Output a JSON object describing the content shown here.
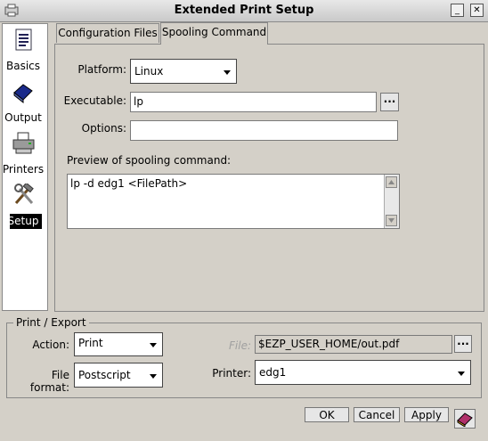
{
  "window": {
    "title": "Extended Print Setup",
    "min_label": "_",
    "max_label": "□",
    "close_label": "✕"
  },
  "sidebar": {
    "items": [
      {
        "label": "Basics",
        "icon": "document-icon"
      },
      {
        "label": "Output",
        "icon": "book-icon"
      },
      {
        "label": "Printers",
        "icon": "printer-icon"
      },
      {
        "label": "Setup",
        "icon": "tools-icon"
      }
    ],
    "selected": "Setup"
  },
  "tabs": [
    {
      "label": "Configuration Files"
    },
    {
      "label": "Spooling Command"
    }
  ],
  "spooling": {
    "platform_label": "Platform:",
    "platform_value": "Linux",
    "executable_label": "Executable:",
    "executable_value": "lp",
    "browse_label": "...",
    "options_label": "Options:",
    "options_value": "",
    "preview_label": "Preview of spooling command:",
    "preview_value": "lp -d edg1  <FilePath>"
  },
  "print_export": {
    "group_title": "Print / Export",
    "action_label": "Action:",
    "action_value": "Print",
    "file_label": "File:",
    "file_value": "$EZP_USER_HOME/out.pdf",
    "file_browse_label": "...",
    "format_label": "File format:",
    "format_value": "Postscript",
    "printer_label": "Printer:",
    "printer_value": "edg1"
  },
  "buttons": {
    "ok": "OK",
    "cancel": "Cancel",
    "apply": "Apply",
    "help_icon": "help-book-icon"
  },
  "colors": {
    "window_bg": "#d4d0c8",
    "sidebar_selected_bg": "#000000",
    "sidebar_selected_fg": "#ffffff",
    "disabled_text": "#a0a0a0"
  }
}
